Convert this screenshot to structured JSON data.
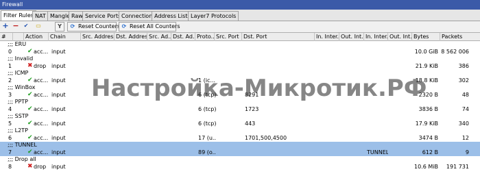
{
  "window": {
    "title": "Firewall"
  },
  "tabs": [
    {
      "label": "Filter Rules",
      "active": true
    },
    {
      "label": "NAT"
    },
    {
      "label": "Mangle"
    },
    {
      "label": "Raw"
    },
    {
      "label": "Service Ports"
    },
    {
      "label": "Connections"
    },
    {
      "label": "Address Lists"
    },
    {
      "label": "Layer7 Protocols"
    }
  ],
  "toolbar": {
    "add_icon": "plus-icon",
    "remove_icon": "minus-icon",
    "enable_icon": "check-icon",
    "comment_icon": "comment-icon",
    "filter_icon": "filter-icon",
    "reset_counters": "Reset Counters",
    "reset_all_counters": "Reset All Counters",
    "reset_icon": "counter-reset-icon",
    "comment_symbol": "▭",
    "reset_symbol": "⟳"
  },
  "columns": [
    "#",
    "",
    "Action",
    "Chain",
    "Src. Address",
    "Dst. Address",
    "Src. Ad...",
    "Dst. Ad...",
    "Proto...",
    "Src. Port",
    "Dst. Port",
    "In. Inter...",
    "Out. Int...",
    "In. Inter...",
    "Out. Int...",
    "Bytes",
    "Packets"
  ],
  "rules": [
    {
      "comment": ";;; ERU",
      "num": "0",
      "action": "acc...",
      "action_type": "accept",
      "chain": "input",
      "proto": "",
      "dst_port": "",
      "in_iface_list": "",
      "bytes": "10.0 GiB",
      "packets": "8 562 006"
    },
    {
      "comment": ";;; Invalid",
      "num": "1",
      "action": "drop",
      "action_type": "drop",
      "chain": "input",
      "proto": "",
      "dst_port": "",
      "in_iface_list": "",
      "bytes": "21.9 KiB",
      "packets": "386"
    },
    {
      "comment": ";;; ICMP",
      "num": "2",
      "action": "acc...",
      "action_type": "accept",
      "chain": "input",
      "proto": "1 (ic...",
      "dst_port": "",
      "in_iface_list": "",
      "bytes": "18.8 KiB",
      "packets": "302"
    },
    {
      "comment": ";;; WinBox",
      "num": "3",
      "action": "acc...",
      "action_type": "accept",
      "chain": "input",
      "proto": "6 (tcp)",
      "dst_port": "8291",
      "in_iface_list": "",
      "bytes": "2320 B",
      "packets": "48"
    },
    {
      "comment": ";;; PPTP",
      "num": "4",
      "action": "acc...",
      "action_type": "accept",
      "chain": "input",
      "proto": "6 (tcp)",
      "dst_port": "1723",
      "in_iface_list": "",
      "bytes": "3836 B",
      "packets": "74"
    },
    {
      "comment": ";;; SSTP",
      "num": "5",
      "action": "acc...",
      "action_type": "accept",
      "chain": "input",
      "proto": "6 (tcp)",
      "dst_port": "443",
      "in_iface_list": "",
      "bytes": "17.9 KiB",
      "packets": "340"
    },
    {
      "comment": ";;; L2TP",
      "num": "6",
      "action": "acc...",
      "action_type": "accept",
      "chain": "input",
      "proto": "17 (u...",
      "dst_port": "1701,500,4500",
      "in_iface_list": "",
      "bytes": "3474 B",
      "packets": "12"
    },
    {
      "comment": ";;; TUNNEL",
      "num": "7",
      "action": "acc...",
      "action_type": "accept",
      "chain": "input",
      "proto": "89 (o...",
      "dst_port": "",
      "in_iface_list": "TUNNEL",
      "bytes": "612 B",
      "packets": "9",
      "selected": true
    },
    {
      "comment": ";;; Drop all",
      "num": "8",
      "action": "drop",
      "action_type": "drop",
      "chain": "input",
      "proto": "",
      "dst_port": "",
      "in_iface_list": "",
      "bytes": "10.6 MiB",
      "packets": "191 731"
    }
  ],
  "icons": {
    "accept": "✔",
    "drop": "✖"
  },
  "watermark": "Настройка-Микротик.РФ"
}
